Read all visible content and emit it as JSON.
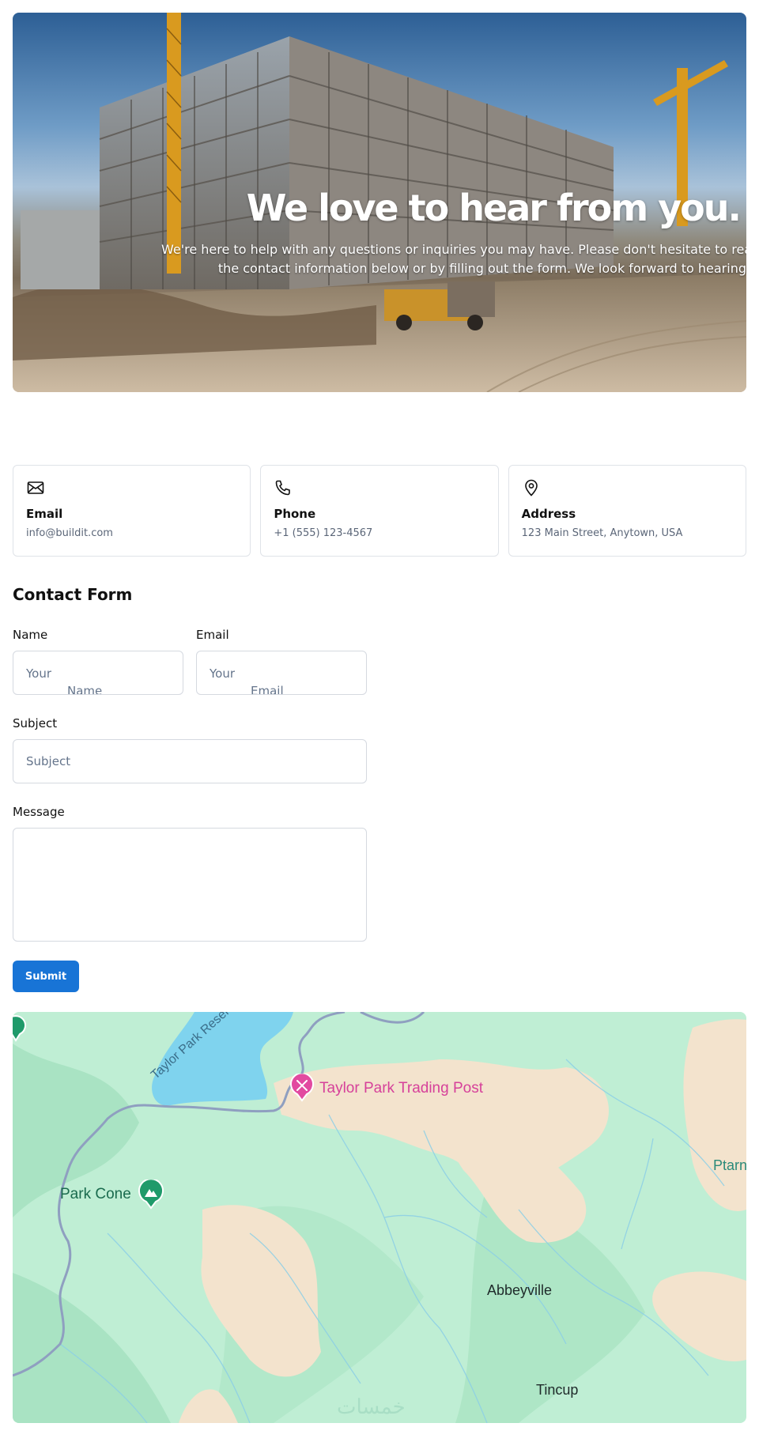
{
  "hero": {
    "title": "We love to hear from you.",
    "text_line1": "We're here to help with any questions or inquiries you may have. Please don't hesitate to rea",
    "text_line2": "the contact information below or by filling out the form. We look forward to hearing"
  },
  "contact_cards": [
    {
      "icon": "envelope-icon",
      "title": "Email",
      "value": "info@buildit.com"
    },
    {
      "icon": "phone-icon",
      "title": "Phone",
      "value": "+1 (555) 123-4567"
    },
    {
      "icon": "map-pin-icon",
      "title": "Address",
      "value": "123 Main Street, Anytown, USA"
    }
  ],
  "form": {
    "title": "Contact Form",
    "name_label": "Name",
    "name_placeholder_line1": "Your",
    "name_placeholder_line2": "Name",
    "email_label": "Email",
    "email_placeholder_line1": "Your",
    "email_placeholder_line2": "Email",
    "subject_label": "Subject",
    "subject_placeholder": "Subject",
    "message_label": "Message",
    "message_value": "",
    "submit_label": "Submit"
  },
  "map": {
    "labels": {
      "reservoir": "Taylor Park Reser",
      "trading_post": "Taylor Park Trading Post",
      "park_cone": "Park Cone",
      "abbeyville": "Abbeyville",
      "tincup": "Tincup",
      "edge_label": "Ptarn"
    },
    "watermark": "خمسات",
    "colors": {
      "land": "#bfeed4",
      "bare_ground": "#f3e3cd",
      "water": "#7fd3ee",
      "pink_pin": "#e24aa0",
      "green_pin": "#1f9a6a"
    }
  }
}
